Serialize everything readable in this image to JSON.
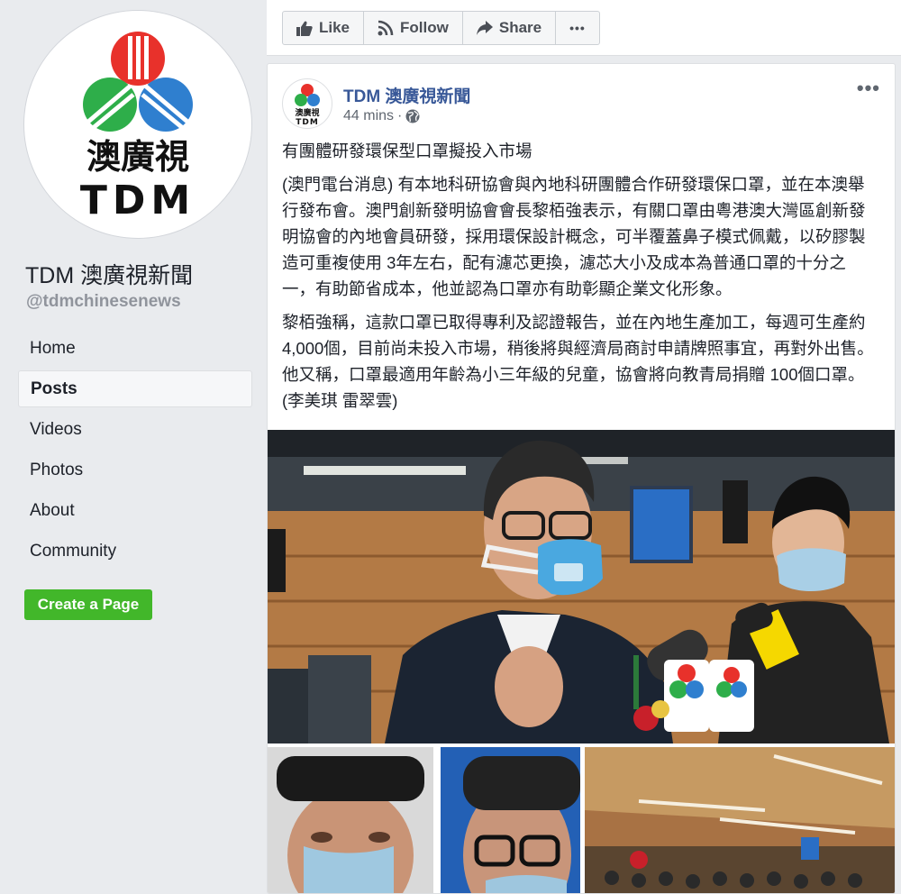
{
  "sidebar": {
    "logo_text_cn": "澳廣視",
    "logo_text_en": "TDM",
    "page_name": "TDM 澳廣視新聞",
    "page_handle": "@tdmchinesenews",
    "nav": [
      {
        "label": "Home"
      },
      {
        "label": "Posts",
        "active": true
      },
      {
        "label": "Videos"
      },
      {
        "label": "Photos"
      },
      {
        "label": "About"
      },
      {
        "label": "Community"
      }
    ],
    "create_page_label": "Create a Page"
  },
  "action_bar": {
    "like_label": "Like",
    "follow_label": "Follow",
    "share_label": "Share",
    "more_label": "•••"
  },
  "post": {
    "author": "TDM 澳廣視新聞",
    "time": "44 mins",
    "separator": "·",
    "avatar_text_cn": "澳廣視",
    "avatar_text_en": "TDM",
    "more_label": "•••",
    "paragraphs": [
      "有團體研發環保型口罩擬投入市場",
      "(澳門電台消息) 有本地科研協會與內地科研團體合作研發環保口罩，並在本澳舉行發布會。澳門創新發明協會會長黎栢強表示，有關口罩由粵港澳大灣區創新發明協會的內地會員研發，採用環保設計概念，可半覆蓋鼻子模式佩戴，以矽膠製造可重複使用 3年左右，配有濾芯更換，濾芯大小及成本為普通口罩的十分之一，有助節省成本，他並認為口罩亦有助彰顯企業文化形象。",
      "黎栢強稱，這款口罩已取得專利及認證報告，並在內地生產加工，每週可生產約 4,000個，目前尚未投入市場，稍後將與經濟局商討申請牌照事宜，再對外出售。他又稱，口罩最適用年齡為小三年級的兒童，協會將向教青局捐贈 100個口罩。 (李美琪 雷翠雲)"
    ]
  },
  "colors": {
    "logo_red": "#e8312b",
    "logo_green": "#2eae4a",
    "logo_blue": "#2f7fcf",
    "link_blue": "#385898",
    "create_green": "#42b72a"
  },
  "icons": {
    "like": "thumbs-up-icon",
    "follow": "rss-icon",
    "share": "share-arrow-icon",
    "privacy": "globe-icon"
  }
}
